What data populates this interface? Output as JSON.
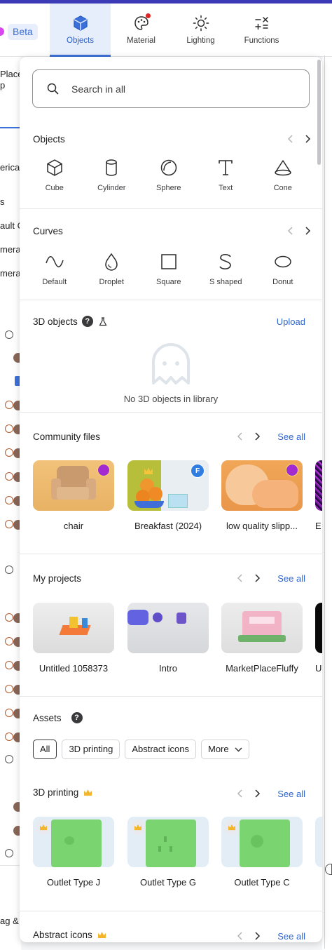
{
  "topbar": {
    "beta_label": "Beta",
    "tabs": [
      {
        "label": "Objects",
        "icon": "cube-icon"
      },
      {
        "label": "Material",
        "icon": "palette-icon"
      },
      {
        "label": "Lighting",
        "icon": "sun-icon"
      },
      {
        "label": "Functions",
        "icon": "math-functions-icon"
      }
    ],
    "active_tab": "Objects",
    "accent": "#3c70d9"
  },
  "left_partial": {
    "items": [
      "Place",
      "p",
      "erica",
      "s",
      "ault C",
      "mera",
      "mera",
      "ag &"
    ]
  },
  "search": {
    "placeholder": "Search in all"
  },
  "objects": {
    "title": "Objects",
    "items": [
      {
        "label": "Cube",
        "icon": "cube-icon"
      },
      {
        "label": "Cylinder",
        "icon": "cylinder-icon"
      },
      {
        "label": "Sphere",
        "icon": "sphere-icon"
      },
      {
        "label": "Text",
        "icon": "text-icon"
      },
      {
        "label": "Cone",
        "icon": "cone-icon"
      }
    ]
  },
  "curves": {
    "title": "Curves",
    "items": [
      {
        "label": "Default",
        "icon": "wave-curve-icon"
      },
      {
        "label": "Droplet",
        "icon": "droplet-icon"
      },
      {
        "label": "Square",
        "icon": "square-icon"
      },
      {
        "label": "S shaped",
        "icon": "s-curve-icon"
      },
      {
        "label": "Donut",
        "icon": "ellipse-icon"
      }
    ]
  },
  "objects3d": {
    "title": "3D objects",
    "upload": "Upload",
    "empty_text": "No 3D objects in library"
  },
  "community": {
    "title": "Community files",
    "see_all": "See all",
    "items": [
      {
        "label": "chair"
      },
      {
        "label": "Breakfast (2024)",
        "badge": "F"
      },
      {
        "label": "low quality slipp..."
      },
      {
        "label": "E"
      }
    ]
  },
  "projects": {
    "title": "My projects",
    "see_all": "See all",
    "items": [
      {
        "label": "Untitled 1058373"
      },
      {
        "label": "Intro"
      },
      {
        "label": "MarketPlaceFluffy"
      },
      {
        "label": "U"
      }
    ]
  },
  "assets": {
    "title": "Assets",
    "chips": [
      "All",
      "3D printing",
      "Abstract icons",
      "More"
    ],
    "selected": "All"
  },
  "printing": {
    "title": "3D printing",
    "see_all": "See all",
    "items": [
      {
        "label": "Outlet Type J"
      },
      {
        "label": "Outlet Type G"
      },
      {
        "label": "Outlet Type C"
      }
    ]
  },
  "abstract": {
    "title": "Abstract icons",
    "see_all": "See all"
  }
}
